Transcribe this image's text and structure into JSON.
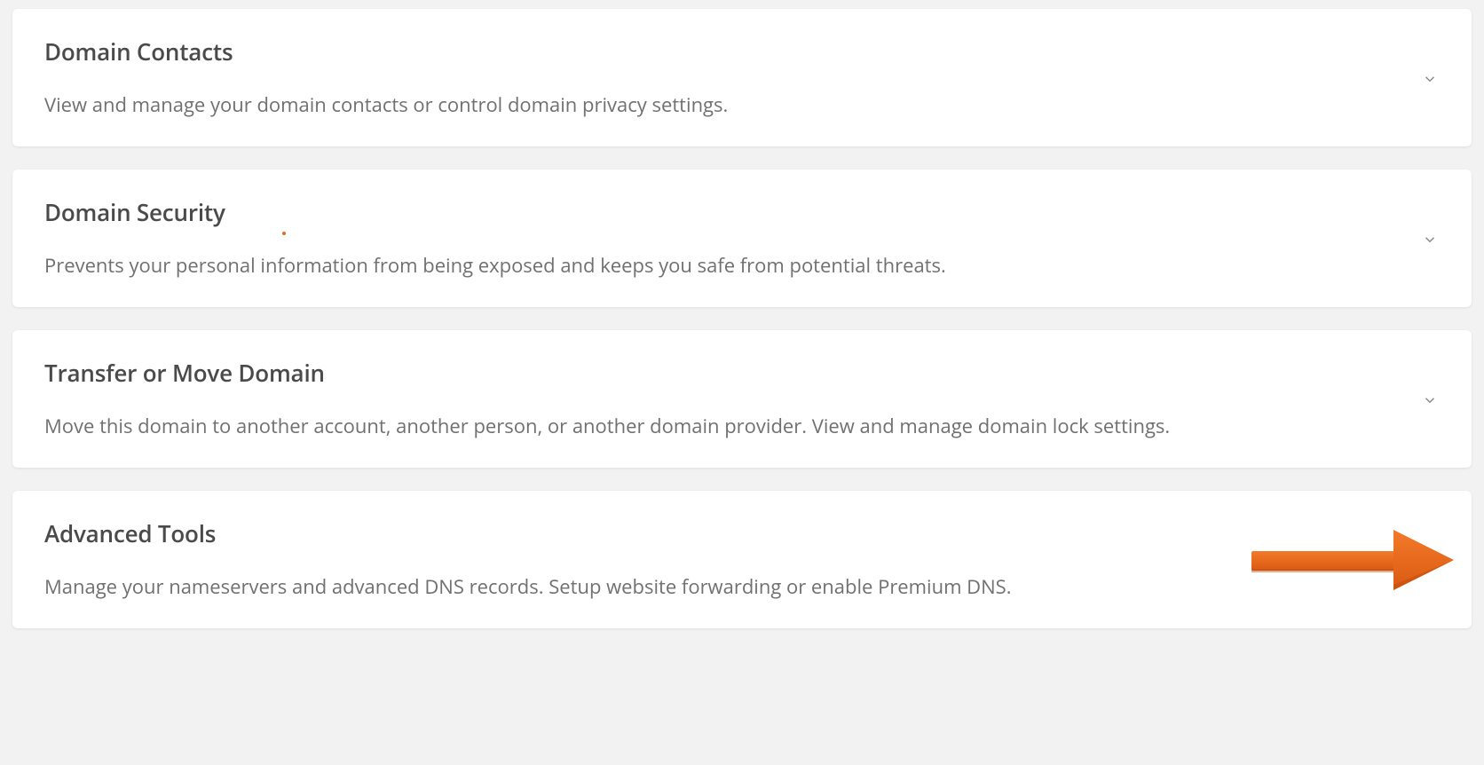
{
  "panels": [
    {
      "title": "Domain Contacts",
      "description": "View and manage your domain contacts or control domain privacy settings."
    },
    {
      "title": "Domain Security",
      "description": "Prevents your personal information from being exposed and keeps you safe from potential threats."
    },
    {
      "title": "Transfer or Move Domain",
      "description": "Move this domain to another account, another person, or another domain provider. View and manage domain lock settings."
    },
    {
      "title": "Advanced Tools",
      "description": "Manage your nameservers and advanced DNS records. Setup website forwarding or enable Premium DNS."
    }
  ],
  "annotation": {
    "arrow_color": "#e86b1c"
  }
}
